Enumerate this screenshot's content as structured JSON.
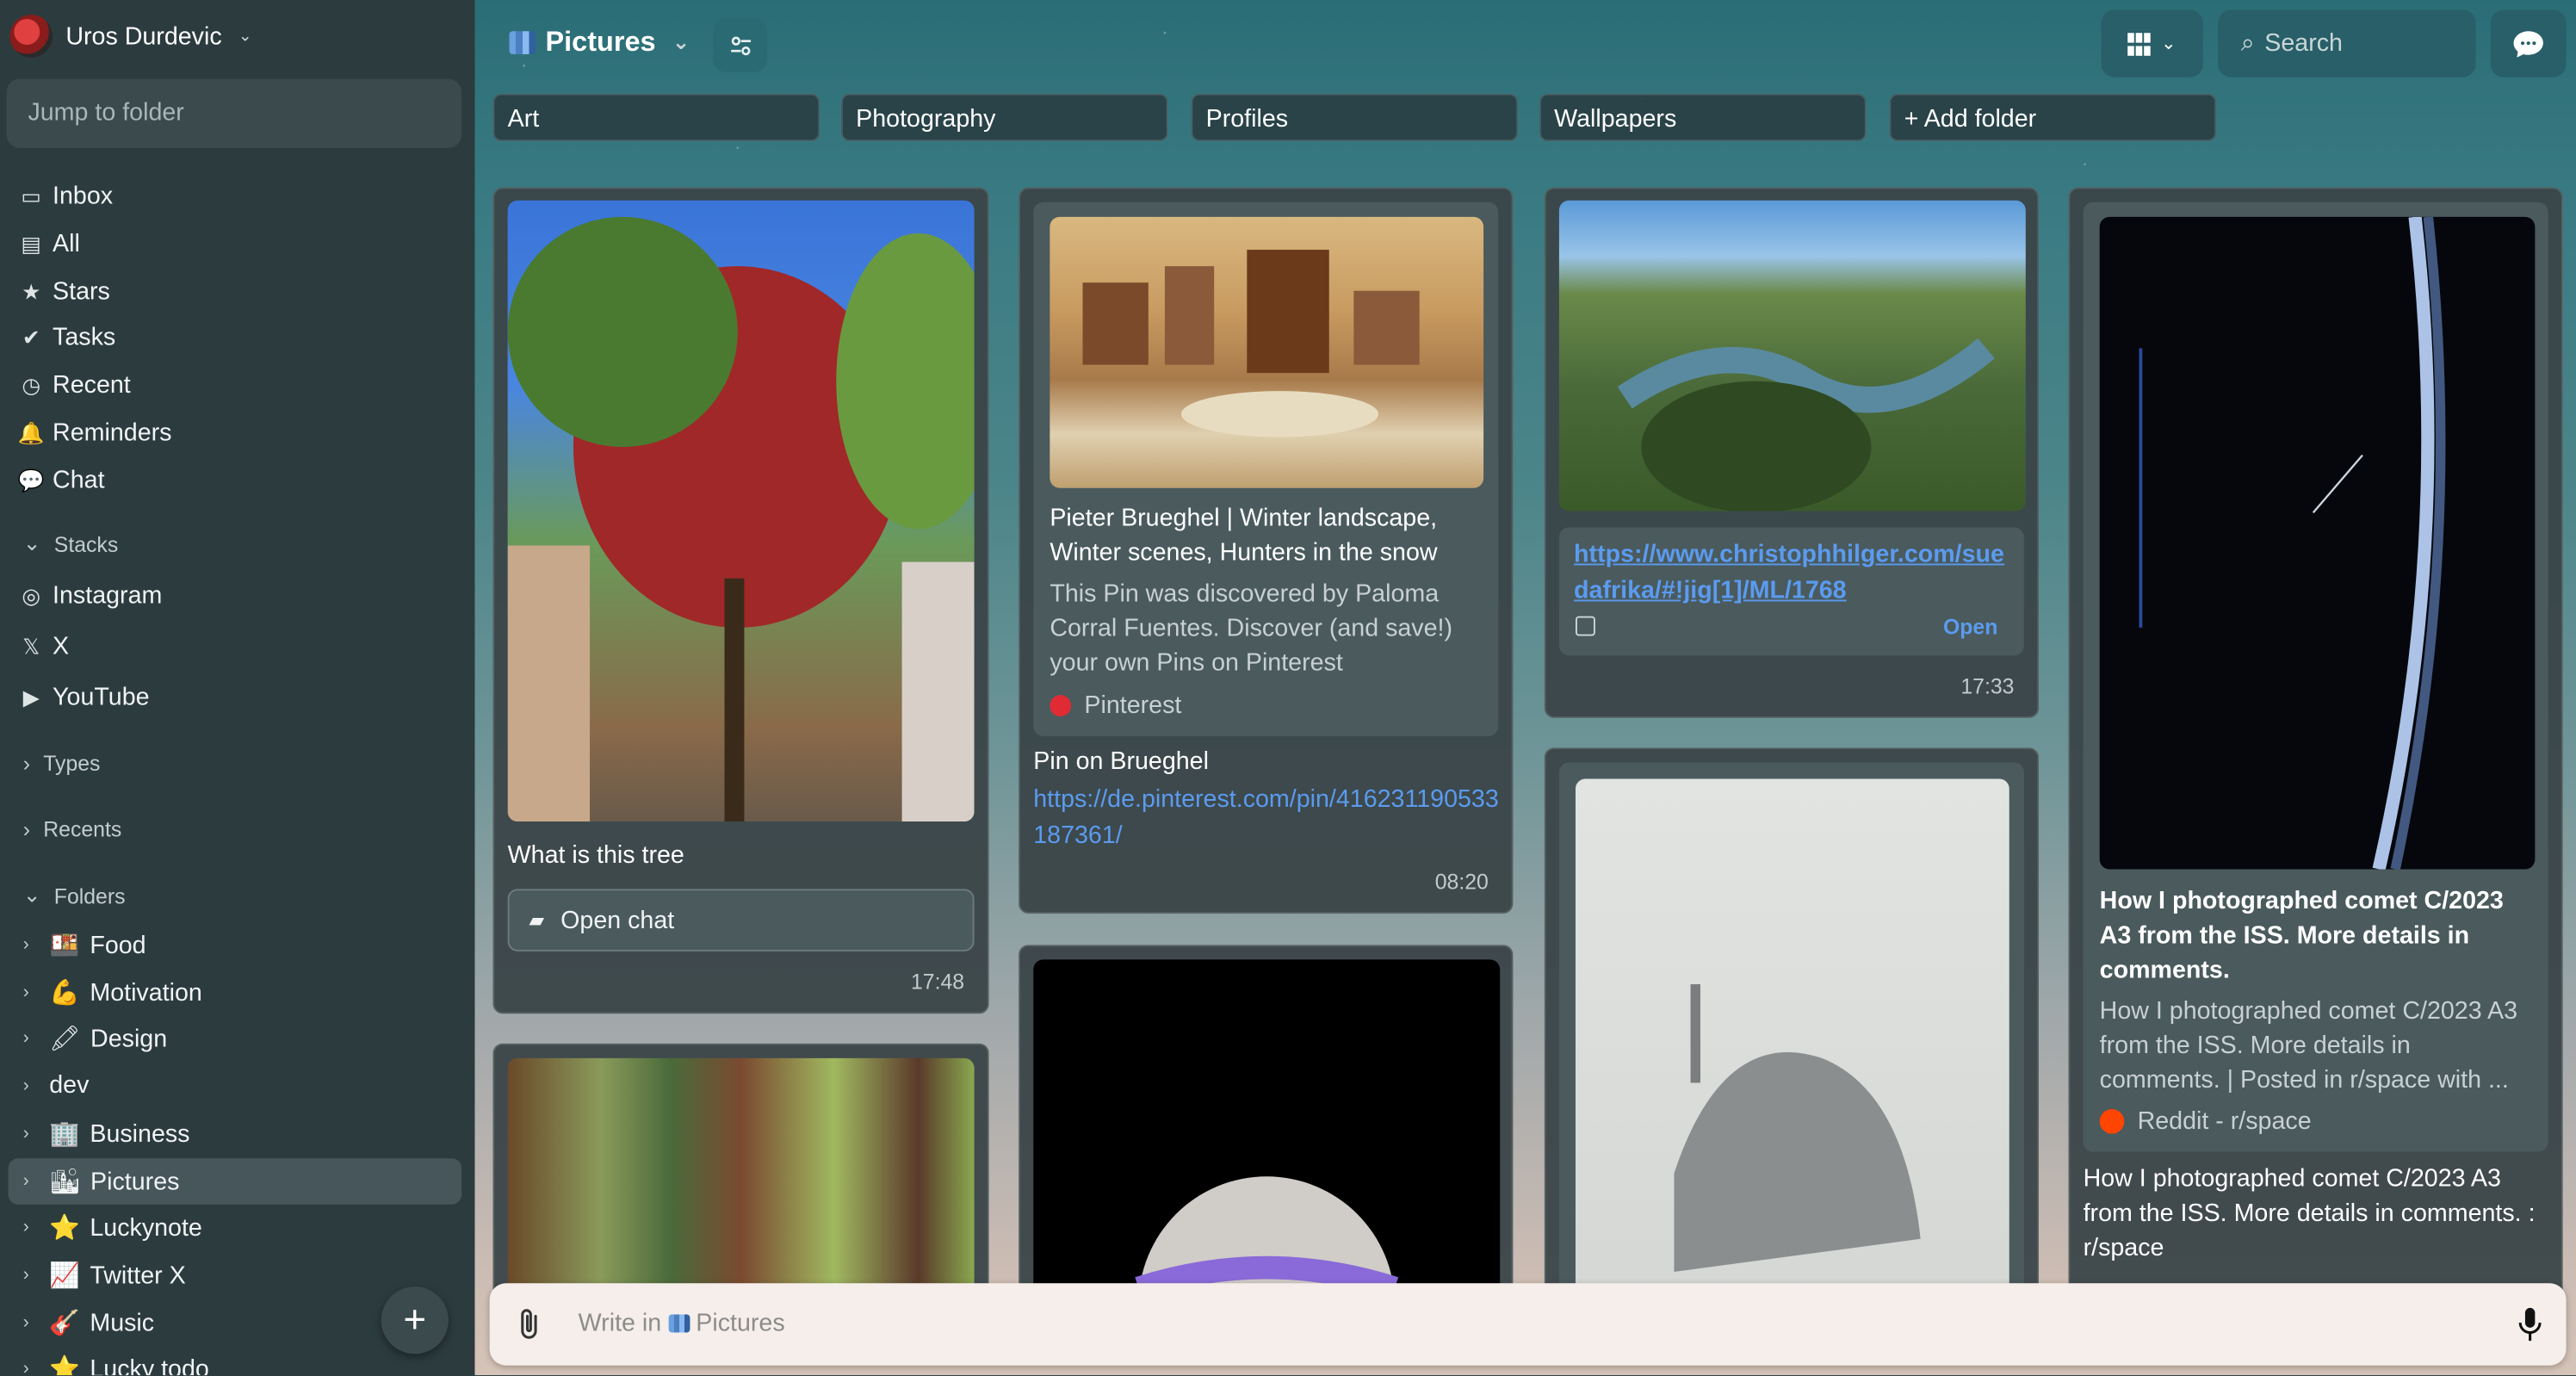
{
  "user": {
    "name": "Uros Durdevic"
  },
  "sidebar": {
    "jump_placeholder": "Jump to folder",
    "nav": [
      {
        "label": "Inbox",
        "icon": "inbox-icon"
      },
      {
        "label": "All",
        "icon": "stack-icon"
      },
      {
        "label": "Stars",
        "icon": "star-icon"
      },
      {
        "label": "Tasks",
        "icon": "check-circle-icon"
      },
      {
        "label": "Recent",
        "icon": "clock-icon"
      },
      {
        "label": "Reminders",
        "icon": "bell-icon"
      },
      {
        "label": "Chat",
        "icon": "chat-icon"
      }
    ],
    "stacks_title": "Stacks",
    "stacks": [
      {
        "label": "Instagram",
        "icon": "instagram-icon"
      },
      {
        "label": "X",
        "icon": "x-icon"
      },
      {
        "label": "YouTube",
        "icon": "youtube-icon"
      }
    ],
    "types_title": "Types",
    "recents_title": "Recents",
    "folders_title": "Folders",
    "folders": [
      {
        "label": "Food",
        "emoji": "🍱"
      },
      {
        "label": "Motivation",
        "emoji": "💪"
      },
      {
        "label": "Design",
        "emoji": "🖍"
      },
      {
        "label": "dev",
        "emoji": ""
      },
      {
        "label": "Business",
        "emoji": "🏢"
      },
      {
        "label": "Pictures",
        "emoji": "🏙"
      },
      {
        "label": "Luckynote",
        "emoji": "⭐"
      },
      {
        "label": "Twitter X",
        "emoji": "📈"
      },
      {
        "label": "Music",
        "emoji": "🎸"
      },
      {
        "label": "Lucky todo",
        "emoji": "⭐"
      }
    ]
  },
  "header": {
    "title": "Pictures",
    "search_placeholder": "Search"
  },
  "subfolders": [
    "Art",
    "Photography",
    "Profiles",
    "Wallpapers",
    "+ Add folder"
  ],
  "cards": {
    "tree": {
      "caption": "What is this tree",
      "open_chat": "Open chat",
      "time": "17:48"
    },
    "brueghel": {
      "title": "Pieter Brueghel | Winter landscape, Winter scenes, Hunters in the snow",
      "desc": "This Pin was discovered by Paloma Corral Fuentes. Discover (and save!) your own Pins on Pinterest",
      "source": "Pinterest",
      "note": "Pin on Brueghel",
      "url": "https://de.pinterest.com/pin/416231190533187361/",
      "time": "08:20"
    },
    "canyon": {
      "url": "https://www.christophhilger.com/suedafrika/#!jig[1]/ML/1768",
      "open": "Open",
      "time": "17:33"
    },
    "comet": {
      "title": "How I photographed comet C/2023 A3 from the ISS. More details in comments.",
      "desc": "How I photographed comet C/2023 A3 from the ISS. More details in comments. | Posted in r/space with ...",
      "source": "Reddit - r/space",
      "note": "How I photographed comet C/2023 A3 from the ISS. More details in comments. : r/space"
    }
  },
  "composer": {
    "placeholder": "Write in",
    "folder": "Pictures"
  },
  "colors": {
    "accent": "#5b9bef",
    "sidebar": "#2c3b3e"
  }
}
